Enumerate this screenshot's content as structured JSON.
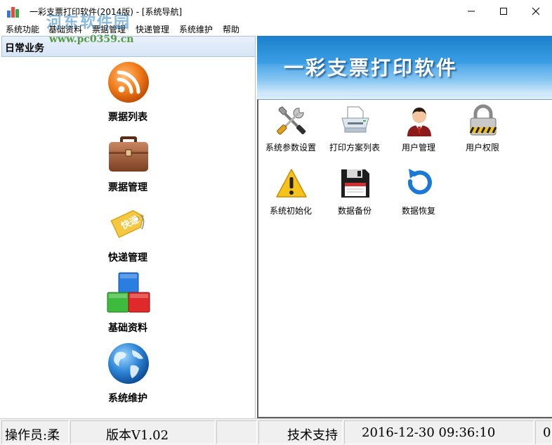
{
  "window": {
    "title": "一彩支票打印软件(2014版) - [系统导航]",
    "controls": {
      "minimize_icon": "minimize-icon",
      "maximize_icon": "maximize-icon",
      "close_icon": "close-icon"
    }
  },
  "watermark": {
    "text": "河东软件园",
    "url": "www.pc0359.cn"
  },
  "menu": [
    "系统功能",
    "基础资料",
    "票据管理",
    "快递管理",
    "系统维护",
    "帮助"
  ],
  "left_panel": {
    "header": "日常业务",
    "items": [
      {
        "label": "票据列表",
        "icon": "rss-icon"
      },
      {
        "label": "票据管理",
        "icon": "briefcase-icon"
      },
      {
        "label": "快递管理",
        "icon": "tag-icon"
      },
      {
        "label": "基础资料",
        "icon": "blocks-icon"
      },
      {
        "label": "系统维护",
        "icon": "globe-icon"
      }
    ]
  },
  "banner": {
    "title": "一彩支票打印软件"
  },
  "right_panel": {
    "items": [
      {
        "label": "系统参数设置",
        "icon": "tools-icon"
      },
      {
        "label": "打印方案列表",
        "icon": "printer-icon"
      },
      {
        "label": "用户管理",
        "icon": "user-icon"
      },
      {
        "label": "用户权限",
        "icon": "lock-icon"
      },
      {
        "label": "系统初始化",
        "icon": "warning-icon"
      },
      {
        "label": "数据备份",
        "icon": "floppy-icon"
      },
      {
        "label": "数据恢复",
        "icon": "restore-icon"
      }
    ]
  },
  "status": {
    "operator": "操作员:柔",
    "version": "版本V1.02",
    "support": "技术支持",
    "datetime": "2016-12-30 09:36:10",
    "extra": "0"
  },
  "colors": {
    "banner_blue": "#1b7fcc",
    "header_bg": "#d6e5f6",
    "status_bg": "#f0f0f0"
  }
}
